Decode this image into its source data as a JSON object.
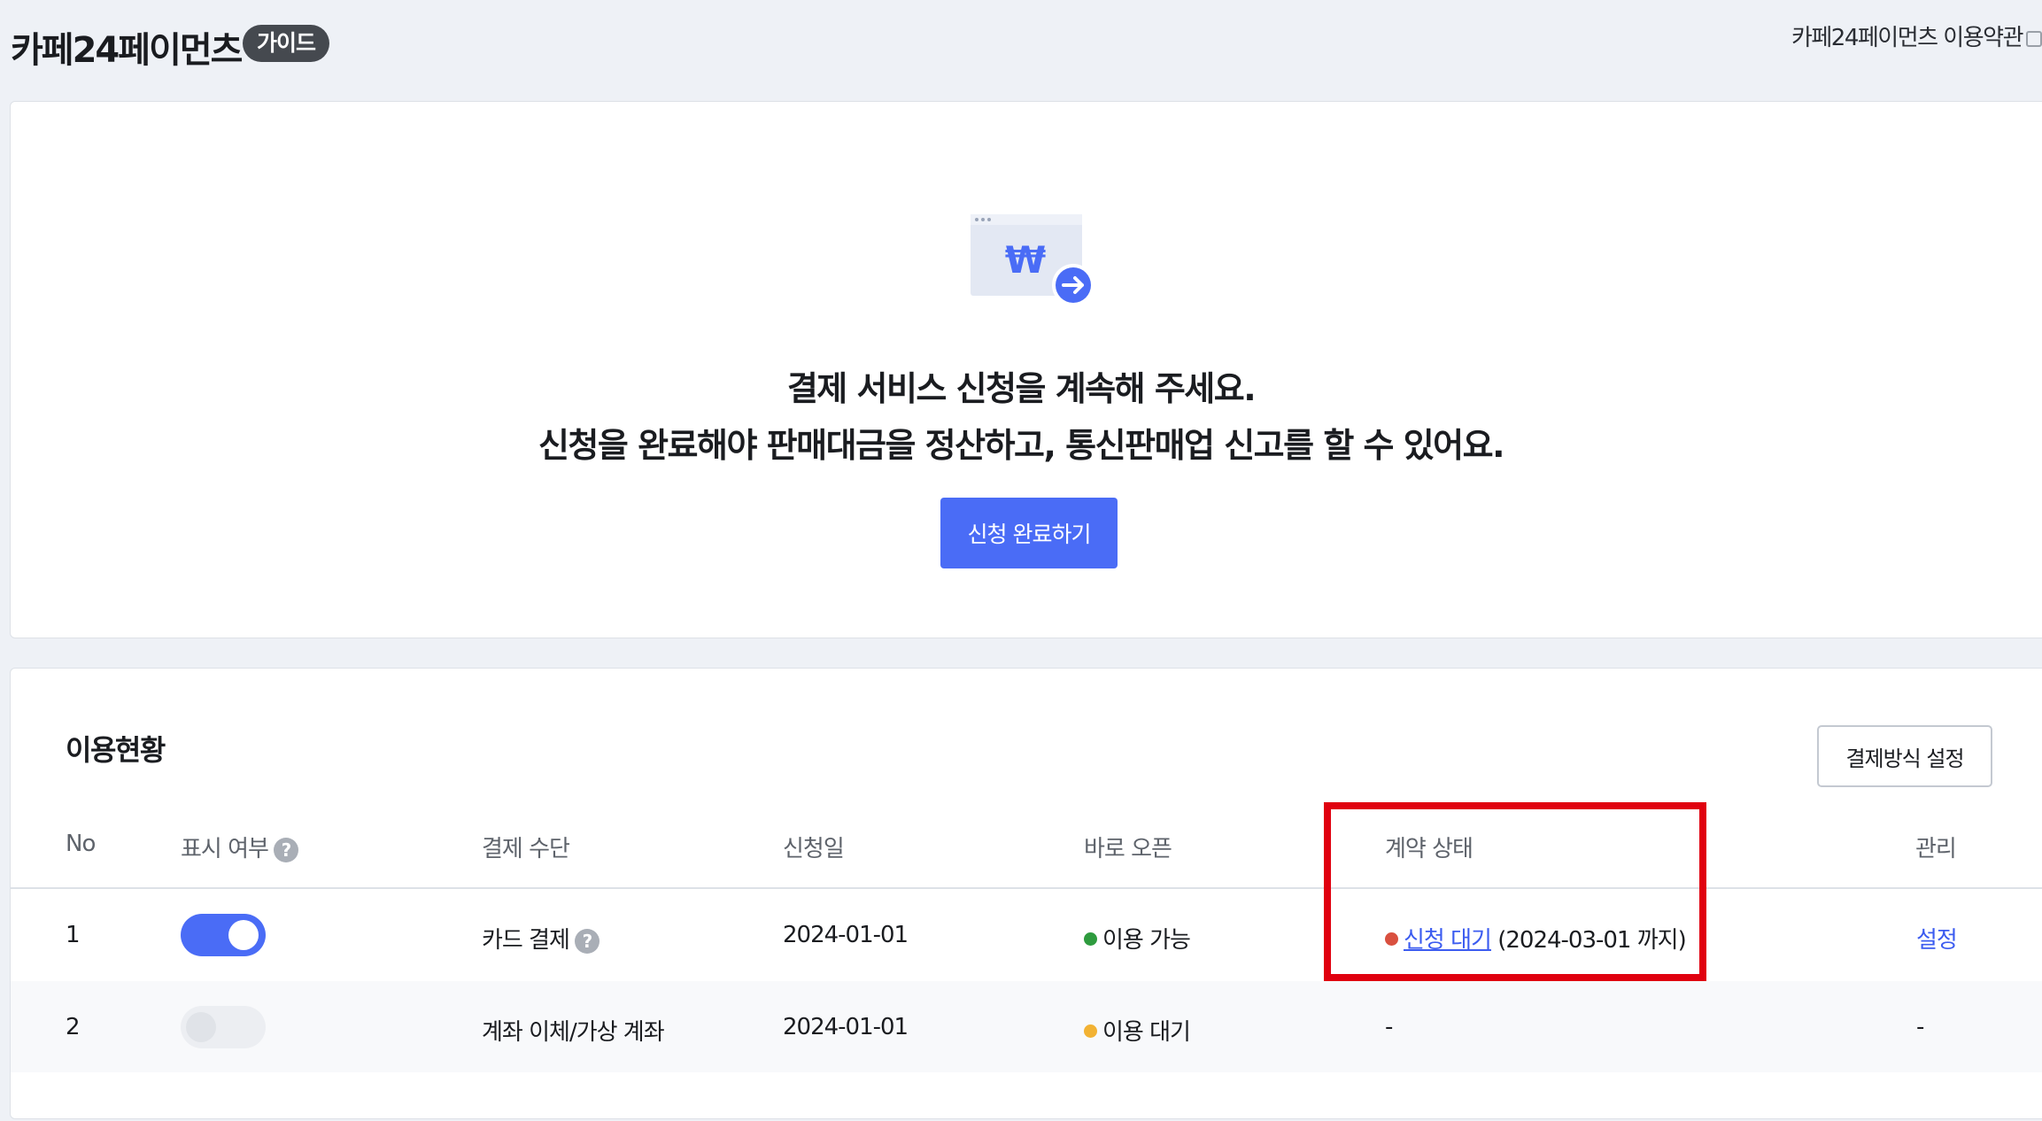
{
  "header": {
    "title": "카페24페이먼츠",
    "badge": "가이드",
    "terms_link": "카페24페이먼츠 이용약관"
  },
  "banner": {
    "illustration_symbol": "₩",
    "line1": "결제 서비스 신청을 계속해 주세요.",
    "line2": "신청을 완료해야 판매대금을 정산하고, 통신판매업 신고를 할 수 있어요.",
    "button": "신청 완료하기"
  },
  "usage": {
    "title": "이용현황",
    "settings_button": "결제방식 설정",
    "columns": {
      "no": "No",
      "display": "표시 여부",
      "method": "결제 수단",
      "date": "신청일",
      "open": "바로 오픈",
      "contract": "계약 상태",
      "manage": "관리"
    },
    "rows": [
      {
        "no": "1",
        "display_on": true,
        "method": "카드 결제",
        "date": "2024-01-01",
        "open_status": "이용 가능",
        "open_color": "#2e9b3e",
        "contract_status": "신청 대기",
        "contract_color": "#d9503f",
        "contract_note": "(2024-03-01 까지)",
        "manage": "설정"
      },
      {
        "no": "2",
        "display_on": false,
        "method": "계좌 이체/가상 계좌",
        "date": "2024-01-01",
        "open_status": "이용 대기",
        "open_color": "#f2b233",
        "contract_status": "-",
        "manage": "-"
      }
    ]
  },
  "colors": {
    "accent": "#4a6cf6",
    "highlight": "#e0000f",
    "background": "#eef1f6"
  }
}
